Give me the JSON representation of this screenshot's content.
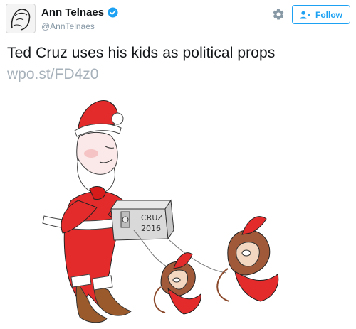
{
  "tweet": {
    "author": {
      "name": "Ann Telnaes",
      "handle": "@AnnTelnaes",
      "verified": true,
      "verified_color": "#1da1f2"
    },
    "actions": {
      "settings_icon": "gear-icon",
      "follow_label": "Follow",
      "follow_icon": "add-user-icon",
      "accent_color": "#1da1f2"
    },
    "text": "Ted Cruz uses his kids as political props",
    "link": "wpo.st/FD4z0",
    "media": {
      "box_label_line1": "CRUZ",
      "box_label_line2": "2016"
    }
  }
}
